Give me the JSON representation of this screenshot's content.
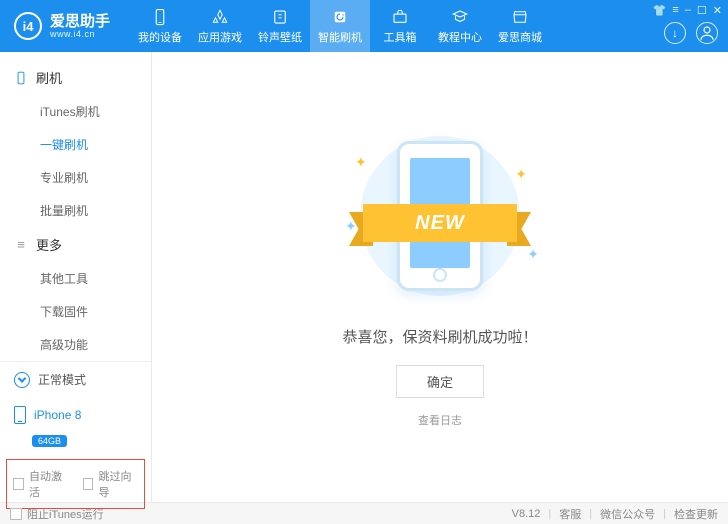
{
  "header": {
    "logo_text": "爱思助手",
    "logo_url": "www.i4.cn",
    "logo_badge": "i4",
    "nav": [
      {
        "label": "我的设备",
        "icon": "device"
      },
      {
        "label": "应用游戏",
        "icon": "apps"
      },
      {
        "label": "铃声壁纸",
        "icon": "ringtone"
      },
      {
        "label": "智能刷机",
        "icon": "flash",
        "active": true
      },
      {
        "label": "工具箱",
        "icon": "toolbox"
      },
      {
        "label": "教程中心",
        "icon": "tutorial"
      },
      {
        "label": "爱思商城",
        "icon": "store"
      }
    ]
  },
  "sidebar": {
    "group1": {
      "title": "刷机",
      "items": [
        "iTunes刷机",
        "一键刷机",
        "专业刷机",
        "批量刷机"
      ],
      "active_index": 1
    },
    "group2": {
      "title": "更多",
      "items": [
        "其他工具",
        "下载固件",
        "高级功能"
      ]
    },
    "mode_label": "正常模式",
    "device_name": "iPhone 8",
    "storage": "64GB",
    "checks": {
      "auto_activate": "自动激活",
      "skip_guide": "跳过向导"
    }
  },
  "main": {
    "ribbon": "NEW",
    "success_text": "恭喜您，保资料刷机成功啦！",
    "ok_btn": "确定",
    "log_link": "查看日志"
  },
  "footer": {
    "block_itunes": "阻止iTunes运行",
    "version": "V8.12",
    "links": [
      "客服",
      "微信公众号",
      "检查更新"
    ]
  }
}
